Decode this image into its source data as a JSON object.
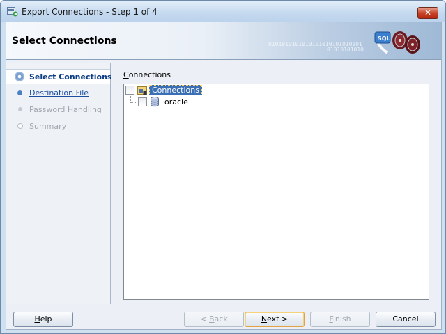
{
  "window": {
    "title": "Export Connections - Step 1 of 4",
    "close_symbol": "✕"
  },
  "header": {
    "title": "Select Connections",
    "binary_1": "0101010101010101010101010101",
    "binary_2": "01010101010",
    "graphic_text": "SQL"
  },
  "nav": {
    "items": [
      {
        "label": "Select Connections",
        "state": "active"
      },
      {
        "label": "Destination File",
        "state": "link"
      },
      {
        "label": "Password Handling",
        "state": "disabled"
      },
      {
        "label": "Summary",
        "state": "disabled"
      }
    ]
  },
  "content": {
    "label_first": "C",
    "label_rest": "onnections",
    "tree": {
      "root": {
        "label": "Connections",
        "checked": false,
        "selected": true
      },
      "children": [
        {
          "label": "oracle",
          "checked": false
        }
      ]
    }
  },
  "buttons": {
    "help": {
      "pre": "",
      "ul": "H",
      "post": "elp"
    },
    "back": {
      "pre": "< ",
      "ul": "B",
      "post": "ack"
    },
    "next": {
      "pre": "",
      "ul": "N",
      "post": "ext >"
    },
    "finish": {
      "pre": "",
      "ul": "F",
      "post": "inish"
    },
    "cancel": {
      "pre": "",
      "ul": "",
      "post": "Cancel"
    }
  },
  "colors": {
    "accent": "#0b3d84",
    "link": "#1b4fa0",
    "selection": "#3a6fb5",
    "close_button": "#c9442a"
  }
}
